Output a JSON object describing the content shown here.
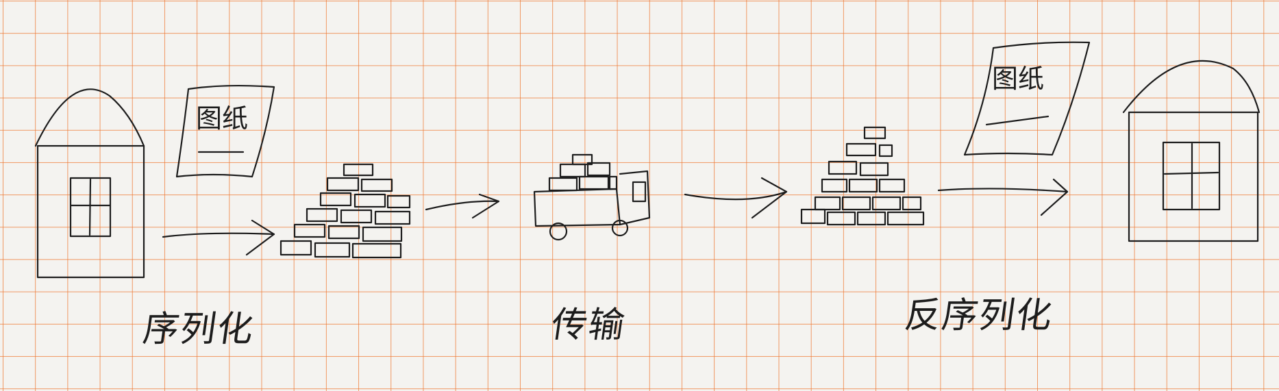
{
  "labels": {
    "serialize": "序列化",
    "transport": "传输",
    "deserialize": "反序列化"
  },
  "blueprint": {
    "left": "图纸",
    "right": "图纸"
  },
  "colors": {
    "ink": "#1c1c1c",
    "grid": "#ee7832",
    "paper": "#f4f3f0"
  }
}
